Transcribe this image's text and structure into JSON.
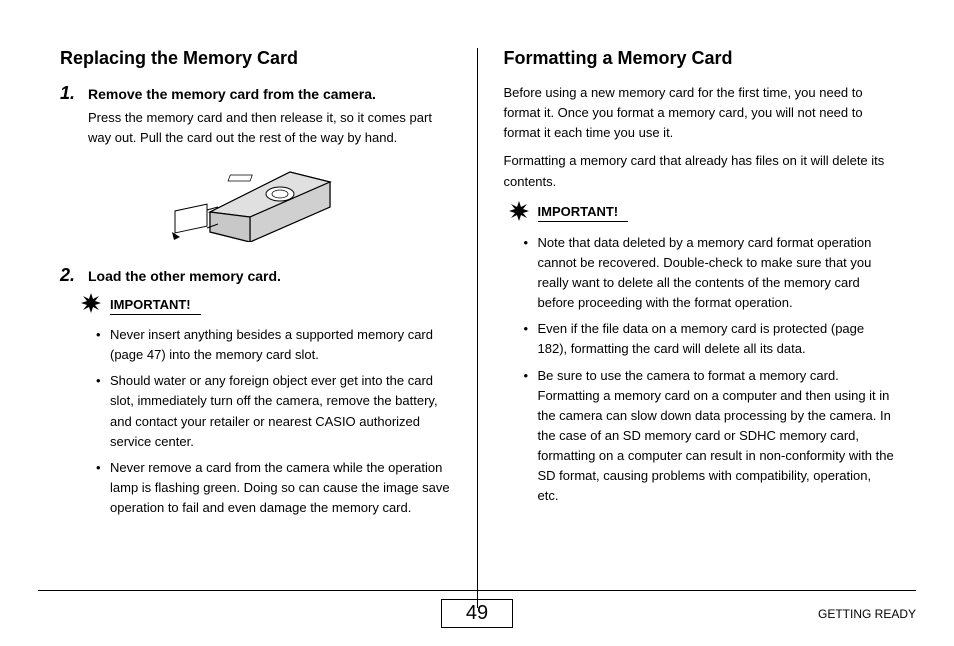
{
  "left": {
    "heading": "Replacing the Memory Card",
    "step1": {
      "num": "1.",
      "title": "Remove the memory card from the camera.",
      "body": "Press the memory card and then release it, so it comes part way out. Pull the card out the rest of the way by hand."
    },
    "step2": {
      "num": "2.",
      "title": "Load the other memory card."
    },
    "importantLabel": "IMPORTANT!",
    "bullets": [
      "Never insert anything besides a supported memory card (page 47) into the memory card slot.",
      "Should water or any foreign object ever get into the card slot, immediately turn off the camera, remove the battery, and contact your retailer or nearest CASIO authorized service center.",
      "Never remove a card from the camera while the operation lamp is flashing green. Doing so can cause the image save operation to fail and even damage the memory card."
    ]
  },
  "right": {
    "heading": "Formatting a Memory Card",
    "intro1": "Before using a new memory card for the first time, you need to format it. Once you format a memory card, you will not need to format it each time you use it.",
    "intro2": "Formatting a memory card that already has files on it will delete its contents.",
    "importantLabel": "IMPORTANT!",
    "bullets": [
      "Note that data deleted by a memory card format operation cannot be recovered. Double-check to make sure that you really want to delete all the contents of the memory card before proceeding with the format operation.",
      "Even if the file data on a memory card is protected (page 182), formatting the card will delete all its data.",
      "Be sure to use the camera to format a memory card. Formatting a memory card on a computer and then using it in the camera can slow down data processing by the camera. In the case of an SD memory card or SDHC memory card, formatting on a computer can result in non-conformity with the SD format, causing problems with compatibility, operation, etc."
    ]
  },
  "footer": {
    "page": "49",
    "section": "GETTING READY"
  }
}
